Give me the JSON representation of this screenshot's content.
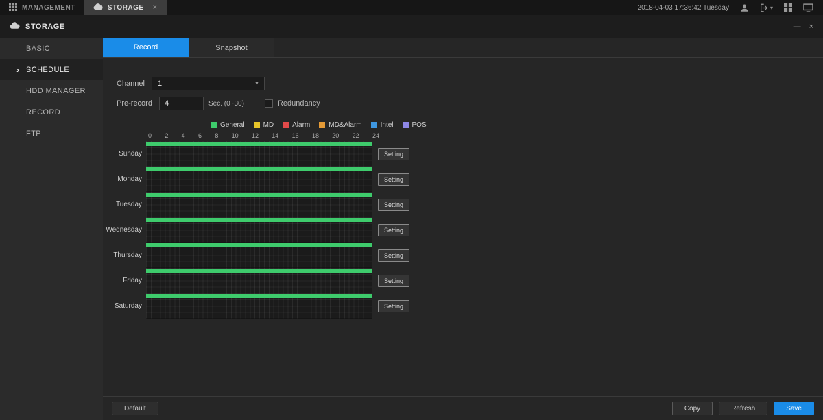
{
  "top_bar": {
    "tabs": [
      {
        "label": "MANAGEMENT"
      },
      {
        "label": "STORAGE"
      }
    ],
    "datetime": "2018-04-03 17:36:42 Tuesday"
  },
  "title_bar": {
    "title": "STORAGE"
  },
  "icons": {
    "tab_close": "×",
    "minimize": "—",
    "close": "×",
    "caret_down": "▾",
    "select_caret": "▼",
    "active_arrow": "›"
  },
  "sidebar": {
    "items": [
      {
        "label": "BASIC",
        "active": false
      },
      {
        "label": "SCHEDULE",
        "active": true
      },
      {
        "label": "HDD MANAGER",
        "active": false
      },
      {
        "label": "RECORD",
        "active": false
      },
      {
        "label": "FTP",
        "active": false
      }
    ]
  },
  "main": {
    "tabs": [
      {
        "label": "Record",
        "active": true
      },
      {
        "label": "Snapshot",
        "active": false
      }
    ],
    "form": {
      "channel_label": "Channel",
      "channel_value": "1",
      "prerecord_label": "Pre-record",
      "prerecord_value": "4",
      "prerecord_unit": "Sec. (0~30)",
      "redundancy_label": "Redundancy",
      "redundancy_checked": false
    },
    "legend": [
      {
        "label": "General",
        "color": "#3ecb6c"
      },
      {
        "label": "MD",
        "color": "#e6c429"
      },
      {
        "label": "Alarm",
        "color": "#e24a4a"
      },
      {
        "label": "MD&Alarm",
        "color": "#e49a36"
      },
      {
        "label": "Intel",
        "color": "#3e97e0"
      },
      {
        "label": "POS",
        "color": "#8e87e6"
      }
    ],
    "schedule": {
      "hours": [
        "0",
        "2",
        "4",
        "6",
        "8",
        "10",
        "12",
        "14",
        "16",
        "18",
        "20",
        "22",
        "24"
      ],
      "days": [
        "Sunday",
        "Monday",
        "Tuesday",
        "Wednesday",
        "Thursday",
        "Friday",
        "Saturday"
      ],
      "setting_label": "Setting",
      "bars_hours": [
        [
          0,
          24
        ],
        [
          0,
          24
        ],
        [
          0,
          24
        ],
        [
          0,
          24
        ],
        [
          0,
          24
        ],
        [
          0,
          24
        ],
        [
          0,
          24
        ]
      ],
      "bar_type": "General"
    }
  },
  "footer": {
    "default_label": "Default",
    "copy_label": "Copy",
    "refresh_label": "Refresh",
    "save_label": "Save"
  },
  "colors": {
    "accent": "#1a8ce8",
    "general": "#3ecb6c"
  }
}
